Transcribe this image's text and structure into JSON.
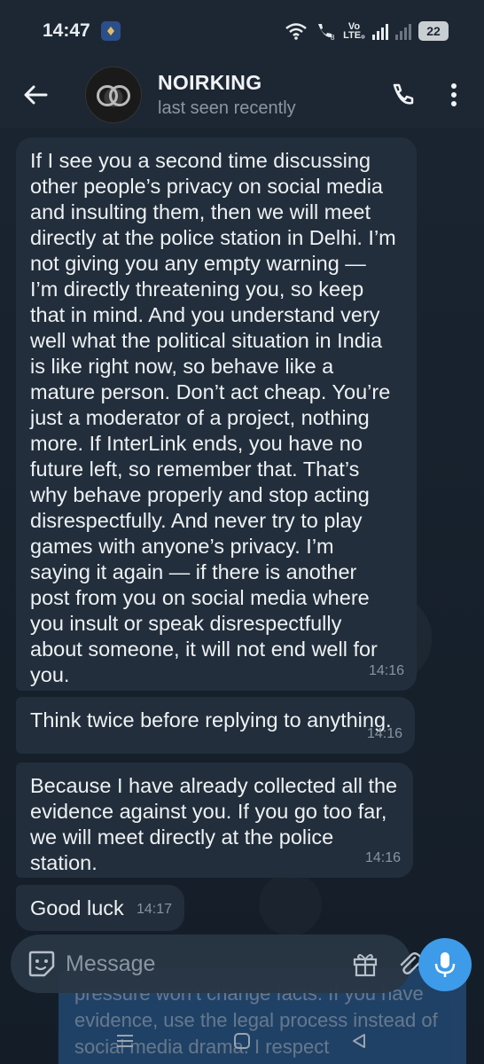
{
  "status_bar": {
    "time": "14:47",
    "network_label_top": "Vo",
    "network_label_bottom": "LTE₀",
    "battery": "22"
  },
  "header": {
    "contact_name": "NOIRKING",
    "contact_status": "last seen recently"
  },
  "messages": [
    {
      "text": "If I see you a second time discussing other people’s privacy on social media and insulting them, then we will meet directly at the police station in Delhi. I’m not giving you any empty warning — I’m directly threatening you, so keep that in mind. And you understand very well what the political situation in India is like right now, so behave like a mature person. Don’t act cheap. You’re just a moderator of a project, nothing more. If InterLink ends, you have no future left, so remember that. That’s why behave properly and stop acting disrespectfully. And never try to play games with anyone’s privacy. I’m saying it again — if there is another post from you on social media where you insult or speak disrespectfully about someone, it will not end well for you.",
      "time": "14:16"
    },
    {
      "text": "Think twice before replying to anything.",
      "time": "14:16"
    },
    {
      "text": "Because I have already collected all the evidence against you. If you go too far, we will meet directly at the police station.",
      "time": "14:16"
    },
    {
      "text": "Good luck",
      "time": "14:17"
    }
  ],
  "underlay_text": "pressure won’t change facts. If you have evidence, use the legal process instead of social media drama. I respect",
  "composer": {
    "placeholder": "Message"
  },
  "icons": {
    "back": "arrow-left-icon",
    "call": "phone-icon",
    "menu": "more-vertical-icon",
    "emoji": "sticker-icon",
    "gift": "gift-icon",
    "attach": "paperclip-icon",
    "mic": "microphone-icon"
  },
  "colors": {
    "header_bg": "#1d2733",
    "bubble_bg": "#222e3b",
    "accent": "#3d9be9"
  }
}
